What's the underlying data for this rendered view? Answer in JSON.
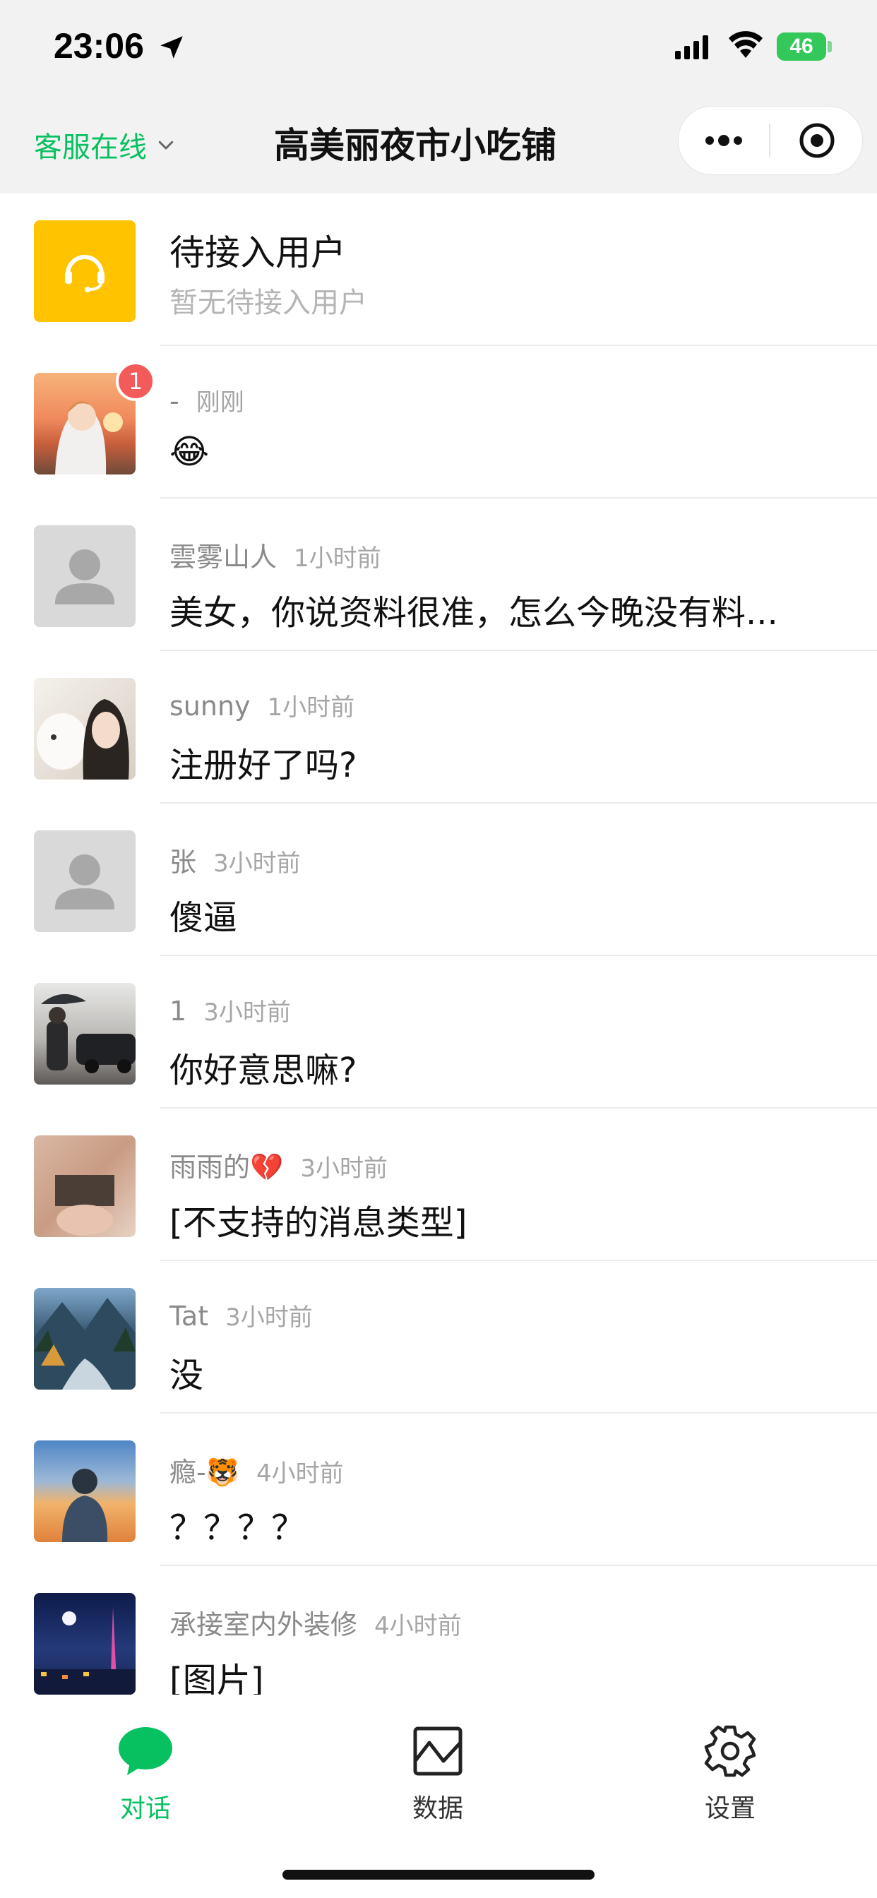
{
  "status_bar": {
    "time": "23:06",
    "battery": "46"
  },
  "header": {
    "service_status": "客服在线",
    "title": "高美丽夜市小吃铺"
  },
  "pending": {
    "title": "待接入用户",
    "subtitle": "暂无待接入用户"
  },
  "conversations": [
    {
      "name": "-",
      "time": "刚刚",
      "message": "😂",
      "badge": "1"
    },
    {
      "name": "雲雾山人",
      "time": "1小时前",
      "message": "美女，你说资料很准，怎么今晚没有料..."
    },
    {
      "name": "sunny",
      "time": "1小时前",
      "message": "注册好了吗?"
    },
    {
      "name": "张",
      "time": "3小时前",
      "message": "傻逼"
    },
    {
      "name": "1",
      "time": "3小时前",
      "message": "你好意思嘛?"
    },
    {
      "name": "雨雨的💔",
      "time": "3小时前",
      "message": "[不支持的消息类型]"
    },
    {
      "name": "Tat",
      "time": "3小时前",
      "message": "没"
    },
    {
      "name": "瘾-🐯",
      "time": "4小时前",
      "message": "？？？？"
    },
    {
      "name": "承接室内外装修",
      "time": "4小时前",
      "message": "[图片]"
    }
  ],
  "tabs": [
    {
      "label": "对话",
      "icon": "chat-bubble-icon",
      "active": true
    },
    {
      "label": "数据",
      "icon": "chart-icon",
      "active": false
    },
    {
      "label": "设置",
      "icon": "gear-icon",
      "active": false
    }
  ],
  "colors": {
    "accent": "#07c160",
    "badge": "#f35b5b",
    "pending_icon_bg": "#ffc300"
  }
}
